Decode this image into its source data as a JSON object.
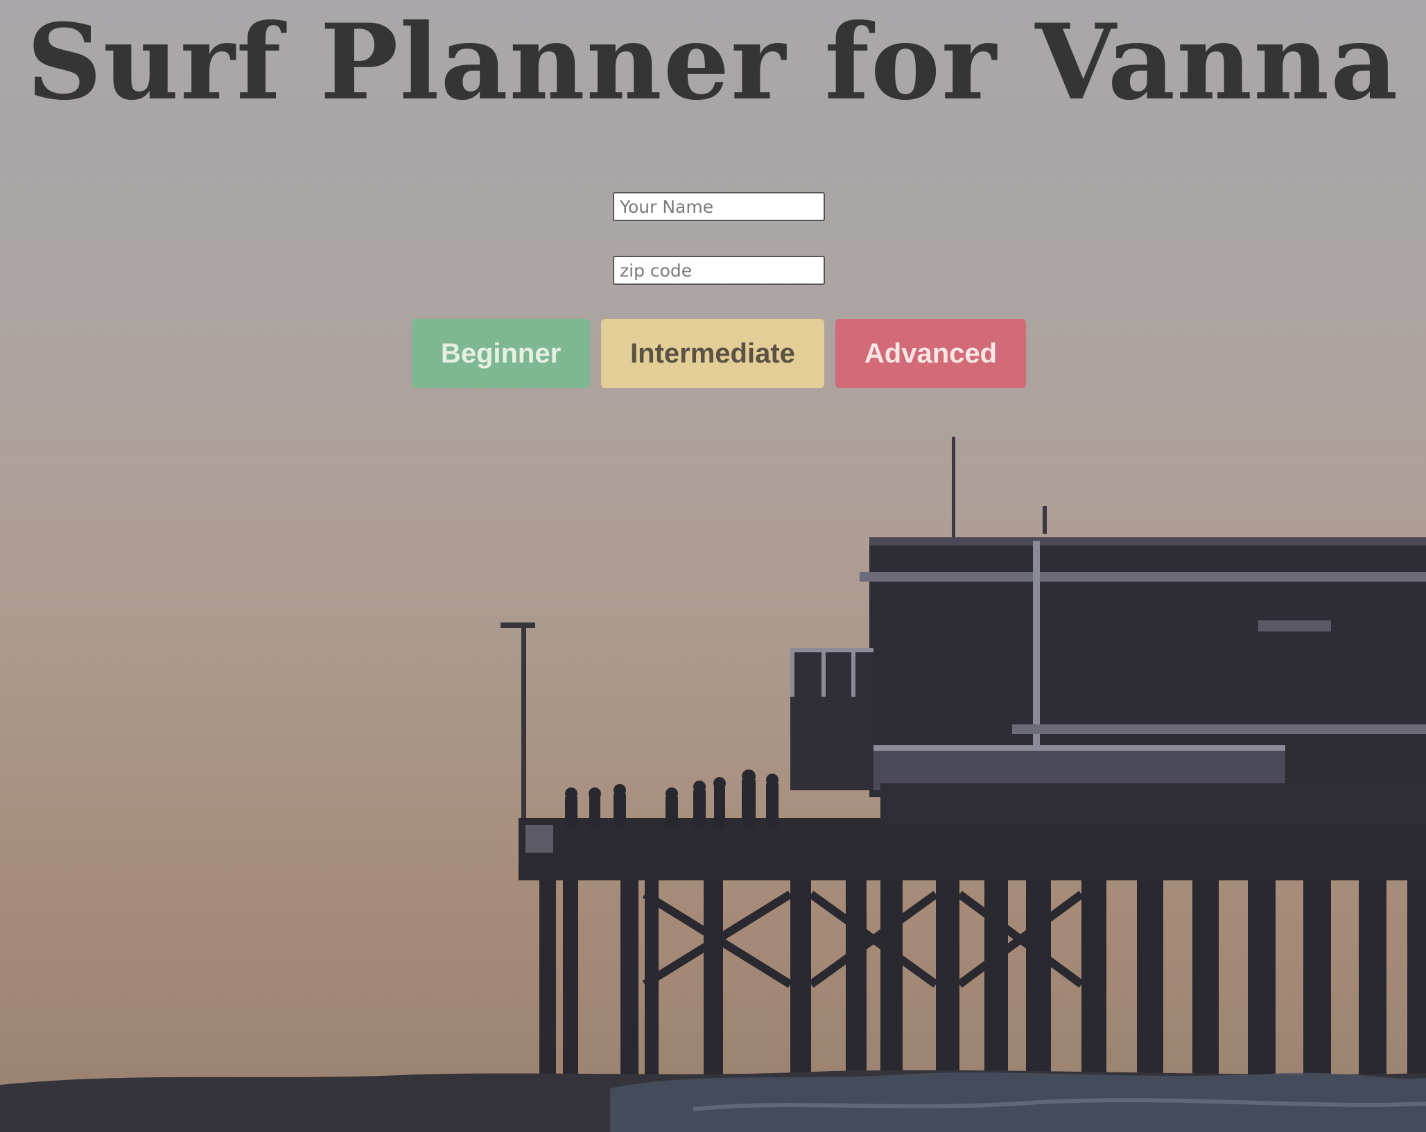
{
  "page": {
    "title": "Surf Planner for Vanna"
  },
  "form": {
    "name_placeholder": "Your Name",
    "zip_placeholder": "zip code"
  },
  "levels": {
    "beginner": {
      "label": "Beginner",
      "color": "#7db892"
    },
    "intermediate": {
      "label": "Intermediate",
      "color": "#e2ce96"
    },
    "advanced": {
      "label": "Advanced",
      "color": "#d36a77"
    }
  }
}
